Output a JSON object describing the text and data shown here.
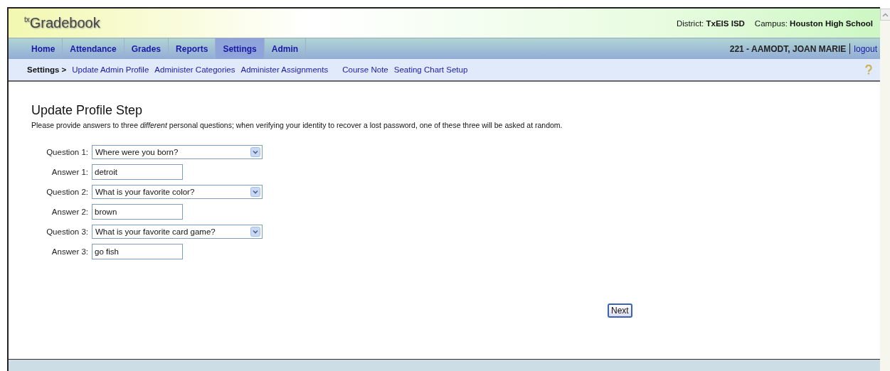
{
  "header": {
    "logo": "$^{tx}$Gradebook",
    "district_label": "District:",
    "district": "TxEIS ISD",
    "campus_label": "Campus:",
    "campus": "Houston High School"
  },
  "nav": {
    "tabs": [
      {
        "label": "Home",
        "selected": false
      },
      {
        "label": "Attendance",
        "selected": false
      },
      {
        "label": "Grades",
        "selected": false
      },
      {
        "label": "Reports",
        "selected": false
      },
      {
        "label": "Settings",
        "selected": true
      },
      {
        "label": "Admin",
        "selected": false
      }
    ],
    "user": "221 - AAMODT, JOAN MARIE",
    "logout": "logout"
  },
  "subnav": {
    "current": "Settings >",
    "links": [
      "Update Admin Profile",
      "Administer Categories",
      "Administer Assignments",
      "Course Note",
      "Seating Chart Setup"
    ]
  },
  "page": {
    "title": "Update Profile Step",
    "instructions": "Please provide answers to three *different* personal questions; when verifying your identity to recover a lost password, one of these three will be asked at random.",
    "fields": [
      {
        "kind": "select",
        "label": "Question 1:",
        "value": "Where were you born?"
      },
      {
        "kind": "text",
        "label": "Answer 1:",
        "value": "detroit"
      },
      {
        "kind": "select",
        "label": "Question 2:",
        "value": "What is your favorite color?"
      },
      {
        "kind": "text",
        "label": "Answer 2:",
        "value": "brown"
      },
      {
        "kind": "select",
        "label": "Question 3:",
        "value": "What is your favorite card game?"
      },
      {
        "kind": "text",
        "label": "Answer 3:",
        "value": "go fish"
      }
    ],
    "next_button": "Next"
  }
}
